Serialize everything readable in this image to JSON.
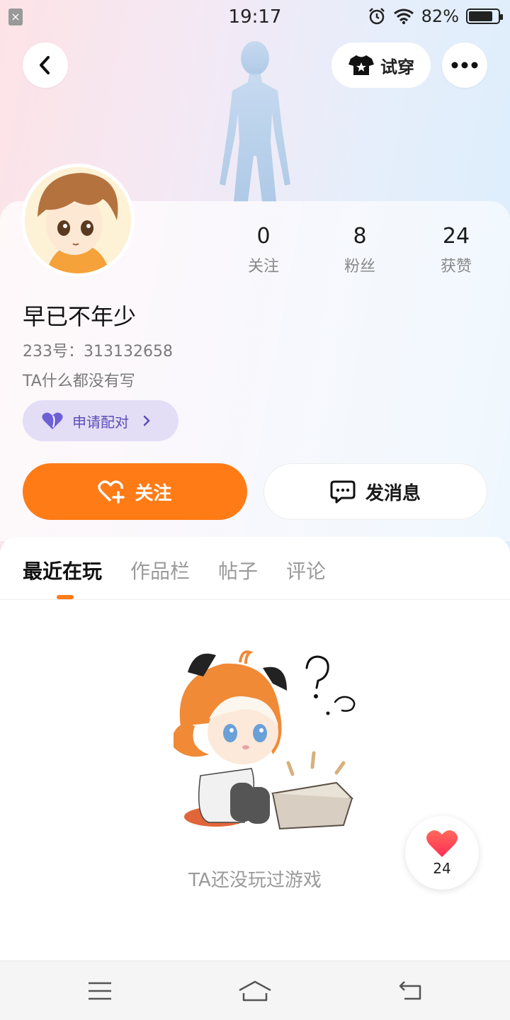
{
  "status_bar": {
    "time": "19:17",
    "battery_percent": "82%",
    "battery_level": 0.82
  },
  "header": {
    "tryon_label": "试穿"
  },
  "profile": {
    "stats": [
      {
        "value": "0",
        "label": "关注"
      },
      {
        "value": "8",
        "label": "粉丝"
      },
      {
        "value": "24",
        "label": "获赞"
      }
    ],
    "nickname": "早已不年少",
    "uid": "233号：313132658",
    "bio": "TA什么都没有写",
    "pair_label": "申请配对"
  },
  "actions": {
    "follow_label": "关注",
    "message_label": "发消息"
  },
  "tabs": [
    "最近在玩",
    "作品栏",
    "帖子",
    "评论"
  ],
  "empty_state": {
    "text": "TA还没玩过游戏"
  },
  "like_fab": {
    "count": "24"
  },
  "colors": {
    "accent": "#ff7b16",
    "pair_bg": "#e4ddf6",
    "pair_text": "#5a4db8"
  }
}
